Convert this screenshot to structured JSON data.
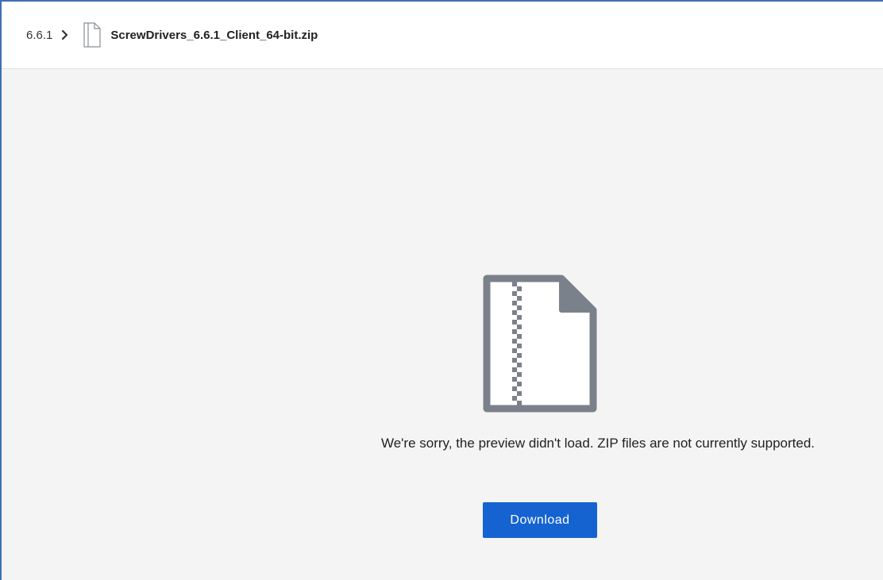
{
  "breadcrumb": {
    "folder": "6.6.1",
    "separator_icon": "chevron-right-icon",
    "file_icon": "file-icon",
    "file_name": "ScrewDrivers_6.6.1_Client_64-bit.zip"
  },
  "preview": {
    "icon": "zip-file-icon",
    "message": "We're sorry, the preview didn't load. ZIP files are not currently supported.",
    "download_label": "Download"
  },
  "colors": {
    "accent": "#1563d1",
    "icon_gray": "#7b818a",
    "background": "#f4f4f4",
    "frame_border": "#3d6fb6"
  }
}
